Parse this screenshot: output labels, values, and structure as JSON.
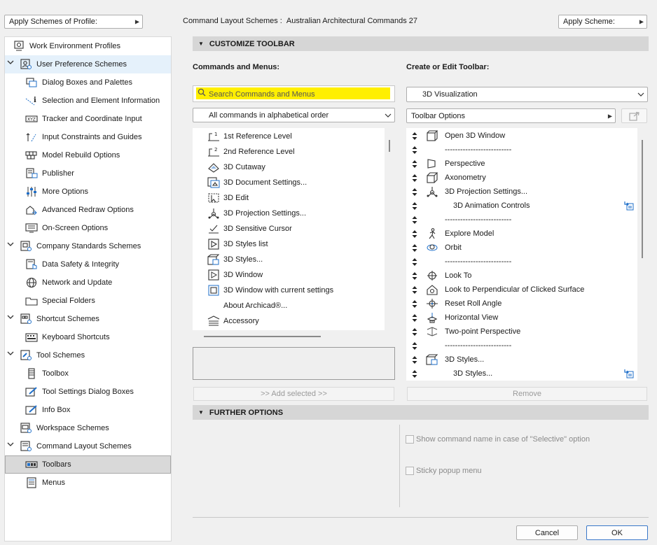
{
  "top": {
    "apply_profile_label": "Apply Schemes of Profile:",
    "scheme_title_prefix": "Command Layout Schemes :",
    "scheme_title_name": "Australian Architectural Commands 27",
    "apply_scheme_label": "Apply Scheme:"
  },
  "tree": {
    "items": [
      {
        "label": "Work Environment Profiles",
        "icon": "profiles-icon"
      },
      {
        "label": "User Preference Schemes",
        "icon": "user-prefs-icon"
      },
      {
        "label": "Dialog Boxes and Palettes",
        "icon": "dialog-icon"
      },
      {
        "label": "Selection and Element Information",
        "icon": "selection-info-icon"
      },
      {
        "label": "Tracker and Coordinate Input",
        "icon": "tracker-icon"
      },
      {
        "label": "Input Constraints and Guides",
        "icon": "constraints-icon"
      },
      {
        "label": "Model Rebuild Options",
        "icon": "rebuild-icon"
      },
      {
        "label": "Publisher",
        "icon": "publisher-icon"
      },
      {
        "label": "More Options",
        "icon": "sliders-icon"
      },
      {
        "label": "Advanced Redraw Options",
        "icon": "redraw-icon"
      },
      {
        "label": "On-Screen Options",
        "icon": "onscreen-icon"
      },
      {
        "label": "Company Standards Schemes",
        "icon": "company-icon"
      },
      {
        "label": "Data Safety & Integrity",
        "icon": "data-safety-icon"
      },
      {
        "label": "Network and Update",
        "icon": "globe-icon"
      },
      {
        "label": "Special Folders",
        "icon": "folder-icon"
      },
      {
        "label": "Shortcut Schemes",
        "icon": "shortcut-icon"
      },
      {
        "label": "Keyboard Shortcuts",
        "icon": "keyboard-icon"
      },
      {
        "label": "Tool Schemes",
        "icon": "tool-schemes-icon"
      },
      {
        "label": "Toolbox",
        "icon": "toolbox-icon"
      },
      {
        "label": "Tool Settings Dialog Boxes",
        "icon": "tool-settings-icon"
      },
      {
        "label": "Info Box",
        "icon": "info-box-icon"
      },
      {
        "label": "Workspace Schemes",
        "icon": "workspace-icon"
      },
      {
        "label": "Command Layout Schemes",
        "icon": "command-layout-icon"
      },
      {
        "label": "Toolbars",
        "icon": "toolbars-icon"
      },
      {
        "label": "Menus",
        "icon": "menus-icon"
      }
    ]
  },
  "customize": {
    "header": "CUSTOMIZE TOOLBAR",
    "commands_label": "Commands and Menus:",
    "create_label": "Create or Edit Toolbar:",
    "search_placeholder": "Search Commands and Menus",
    "filter_value": "All commands in alphabetical order",
    "toolbar_value": "3D Visualization",
    "toolbar_options_label": "Toolbar Options",
    "add_selected_label": ">> Add selected >>",
    "remove_label": "Remove"
  },
  "commands": [
    {
      "label": "1st Reference Level",
      "icon": "ref-level-1-icon"
    },
    {
      "label": "2nd Reference Level",
      "icon": "ref-level-2-icon"
    },
    {
      "label": "3D Cutaway",
      "icon": "cutaway-icon"
    },
    {
      "label": "3D Document Settings...",
      "icon": "3d-document-icon"
    },
    {
      "label": "3D Edit",
      "icon": "3d-edit-icon"
    },
    {
      "label": "3D Projection Settings...",
      "icon": "projection-icon"
    },
    {
      "label": "3D Sensitive Cursor",
      "icon": "sensitive-cursor-icon"
    },
    {
      "label": "3D Styles list",
      "icon": "styles-list-icon"
    },
    {
      "label": "3D Styles...",
      "icon": "3d-styles-icon"
    },
    {
      "label": "3D Window",
      "icon": "3d-window-icon"
    },
    {
      "label": "3D Window with current settings",
      "icon": "3d-window-current-icon"
    },
    {
      "label": "About Archicad®...",
      "icon": ""
    },
    {
      "label": "Accessory",
      "icon": "accessory-icon"
    }
  ],
  "toolbar_items": [
    {
      "label": "Open 3D Window",
      "icon": "open-3d-icon",
      "indent": false,
      "link": false
    },
    {
      "label": "--------------------------",
      "icon": "",
      "indent": false,
      "link": false
    },
    {
      "label": "Perspective",
      "icon": "perspective-icon",
      "indent": false,
      "link": false
    },
    {
      "label": "Axonometry",
      "icon": "axonometry-icon",
      "indent": false,
      "link": false
    },
    {
      "label": "3D Projection Settings...",
      "icon": "projection-icon",
      "indent": false,
      "link": false
    },
    {
      "label": "3D Animation Controls",
      "icon": "",
      "indent": true,
      "link": true
    },
    {
      "label": "--------------------------",
      "icon": "",
      "indent": false,
      "link": false
    },
    {
      "label": "Explore Model",
      "icon": "explore-icon",
      "indent": false,
      "link": false
    },
    {
      "label": "Orbit",
      "icon": "orbit-icon",
      "indent": false,
      "link": false
    },
    {
      "label": "--------------------------",
      "icon": "",
      "indent": false,
      "link": false
    },
    {
      "label": "Look To",
      "icon": "look-to-icon",
      "indent": false,
      "link": false
    },
    {
      "label": "Look to Perpendicular of Clicked Surface",
      "icon": "look-perp-icon",
      "indent": false,
      "link": false
    },
    {
      "label": "Reset Roll Angle",
      "icon": "roll-angle-icon",
      "indent": false,
      "link": false
    },
    {
      "label": "Horizontal View",
      "icon": "horizontal-view-icon",
      "indent": false,
      "link": false
    },
    {
      "label": "Two-point Perspective",
      "icon": "two-point-icon",
      "indent": false,
      "link": false
    },
    {
      "label": "--------------------------",
      "icon": "",
      "indent": false,
      "link": false
    },
    {
      "label": "3D Styles...",
      "icon": "3d-styles-icon",
      "indent": false,
      "link": false
    },
    {
      "label": "3D Styles...",
      "icon": "",
      "indent": true,
      "link": true
    }
  ],
  "further": {
    "header": "FURTHER OPTIONS",
    "show_name_label": "Show command name in case of \"Selective\" option",
    "sticky_label": "Sticky popup menu"
  },
  "footer": {
    "cancel_label": "Cancel",
    "ok_label": "OK"
  }
}
